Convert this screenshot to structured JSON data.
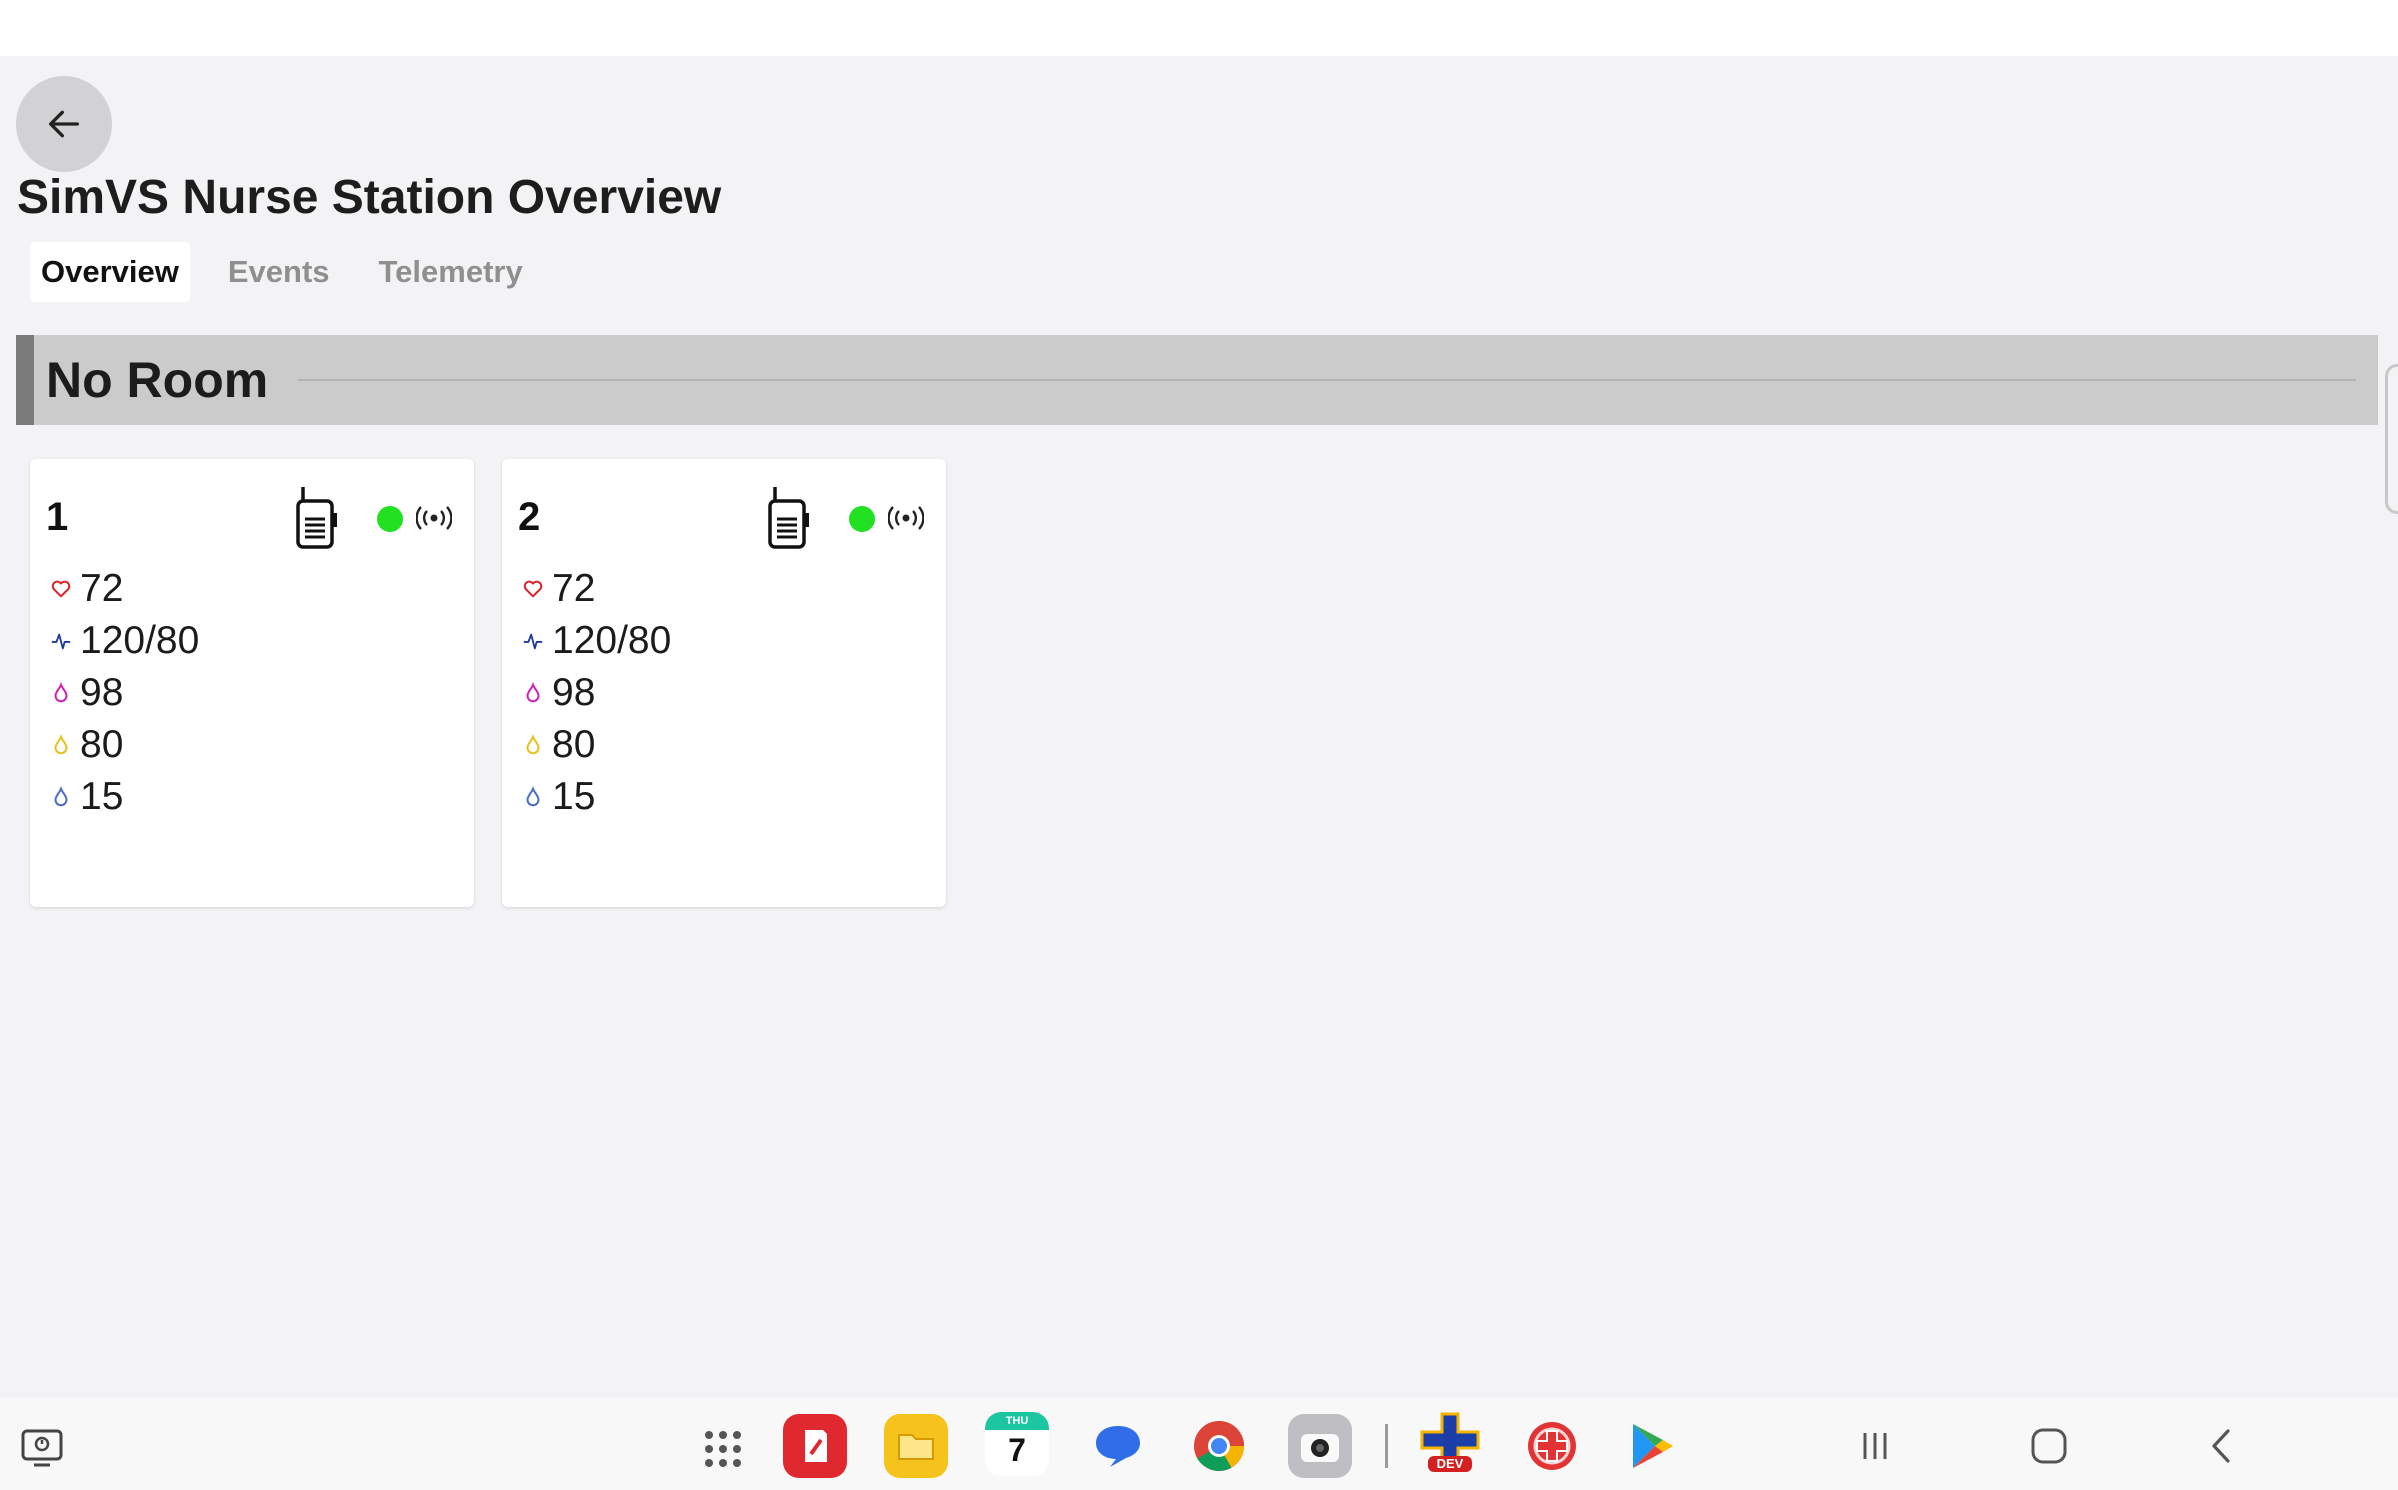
{
  "app": {
    "title": "SimVS Nurse Station Overview"
  },
  "tabs": [
    {
      "label": "Overview",
      "active": true
    },
    {
      "label": "Events",
      "active": false
    },
    {
      "label": "Telemetry",
      "active": false
    }
  ],
  "room": {
    "name": "No Room"
  },
  "patients": [
    {
      "id": "1",
      "device_icon": "walkie-talkie-icon",
      "status_color": "#22e022",
      "signal_icon": "broadcast-icon",
      "vitals": {
        "heart_rate": {
          "icon": "heart-icon",
          "color": "#d9262b",
          "value": "72"
        },
        "blood_pressure": {
          "icon": "pulse-wave-icon",
          "color": "#1e3a9e",
          "value": "120/80"
        },
        "spo2": {
          "icon": "drop-icon",
          "color": "#cc23b5",
          "value": "98"
        },
        "vital_4": {
          "icon": "drop-icon",
          "color": "#e6c21a",
          "value": "80"
        },
        "vital_5": {
          "icon": "drop-icon",
          "color": "#4a6fc2",
          "value": "15"
        }
      }
    },
    {
      "id": "2",
      "device_icon": "walkie-talkie-icon",
      "status_color": "#22e022",
      "signal_icon": "broadcast-icon",
      "vitals": {
        "heart_rate": {
          "icon": "heart-icon",
          "color": "#d9262b",
          "value": "72"
        },
        "blood_pressure": {
          "icon": "pulse-wave-icon",
          "color": "#1e3a9e",
          "value": "120/80"
        },
        "spo2": {
          "icon": "drop-icon",
          "color": "#cc23b5",
          "value": "98"
        },
        "vital_4": {
          "icon": "drop-icon",
          "color": "#e6c21a",
          "value": "80"
        },
        "vital_5": {
          "icon": "drop-icon",
          "color": "#4a6fc2",
          "value": "15"
        }
      }
    }
  ],
  "taskbar": {
    "calendar": {
      "day": "THU",
      "date": "7"
    },
    "dev_badge": "DEV",
    "apps": [
      "apps-grid-icon",
      "notes-icon",
      "files-icon",
      "calendar-icon",
      "messages-icon",
      "chrome-icon",
      "camera-icon",
      "simvs-dev-icon",
      "simvs-icon",
      "play-store-icon"
    ]
  },
  "colors": {
    "accent_green": "#22e022",
    "header_bar": "#cbcbcb",
    "header_accent": "#7b7b7b",
    "background": "#f3f3f5"
  }
}
